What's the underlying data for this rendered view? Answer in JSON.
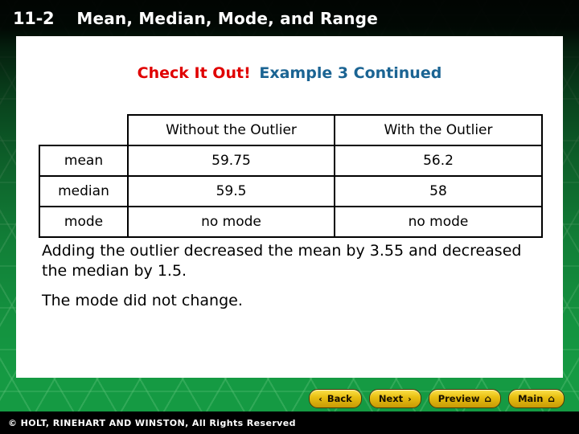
{
  "slide": {
    "lesson_number": "11-2",
    "lesson_title": "Mean, Median, Mode, and Range",
    "callout_red": "Check It Out!",
    "callout_blue": "Example 3 Continued",
    "colors": {
      "callout_red": "#e00000",
      "callout_blue": "#1b6493",
      "background_green": "#159a43",
      "panel_white": "#ffffff",
      "button_gold": "#e8bf12",
      "footer_black": "#000000"
    }
  },
  "table": {
    "corner_label": "",
    "columns": [
      "Without the Outlier",
      "With the Outlier"
    ],
    "rows": [
      {
        "label": "mean",
        "without": "59.75",
        "with": "56.2"
      },
      {
        "label": "median",
        "without": "59.5",
        "with": "58"
      },
      {
        "label": "mode",
        "without": "no mode",
        "with": "no mode"
      }
    ]
  },
  "body": {
    "paragraph_1": "Adding the outlier decreased the mean by 3.55 and decreased the median by 1.5.",
    "paragraph_2": "The mode did not change."
  },
  "nav": {
    "buttons": [
      {
        "label": "Back",
        "icon": "chevron-left-icon",
        "glyph": "‹"
      },
      {
        "label": "Next",
        "icon": "chevron-right-icon",
        "glyph": "›"
      },
      {
        "label": "Preview",
        "icon": "home-icon",
        "glyph": "⌂"
      },
      {
        "label": "Main",
        "icon": "home-icon",
        "glyph": "⌂"
      }
    ]
  },
  "footer": {
    "copyright": "© HOLT, RINEHART AND WINSTON, All Rights Reserved"
  }
}
